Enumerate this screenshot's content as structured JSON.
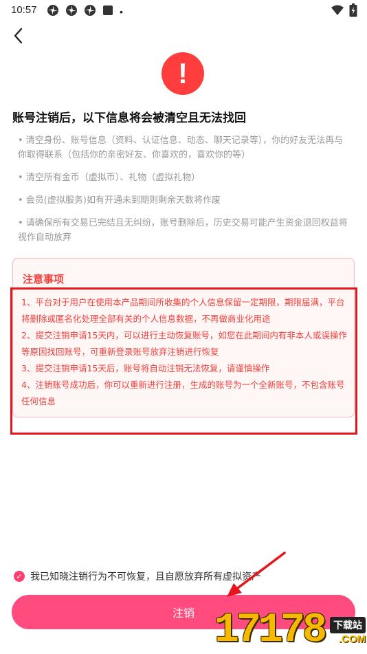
{
  "status_bar": {
    "time": "10:57",
    "icons": [
      "pinwheel-icon",
      "pinwheel-icon",
      "pinwheel-icon",
      "square-icon",
      "dot-icon"
    ],
    "dot": "•"
  },
  "header": {
    "back_icon": "chevron-left-icon"
  },
  "warning_icon": {
    "glyph": "!",
    "color": "#ff3d3d"
  },
  "heading": "账号注销后，以下信息将会被清空且无法找回",
  "info_items": [
    "• 清空身份、账号信息（资料、认证信息、动态、聊天记录等），你的好友无法再与你取得联系（包括你的亲密好友、你喜欢的，喜欢你的等）",
    "• 清空所有金币（虚拟币）、礼物（虚拟礼物）",
    "• 会员(虚拟服务)如有开通未到期则剩余天数将作废",
    "• 请确保所有交易已完结且无纠纷，账号删除后，历史交易可能产生资金退回权益将视作自动放弃"
  ],
  "notice": {
    "title": "注意事项",
    "items": [
      "1、平台对于用户在使用本产品期间所收集的个人信息保留一定期限，期限届满，平台将删除或匿名化处理全部有关的个人信息数据，不再做商业化用途",
      "2、提交注销申请15天内，可以进行主动恢复账号，如您在此期间内有非本人或误操作等原因找回账号，可重新登录账号放弃注销进行恢复",
      "3、提交注销申请15天后，账号将自动注销无法恢复，请谨慎操作",
      "4、注销账号成功后，你可以重新进行注册，生成的账号为一个全新账号，不包含账号任何信息"
    ]
  },
  "agreement": {
    "checked": true,
    "text": "我已知晓注销行为不可恢复，且自愿放弃所有虚拟资产"
  },
  "cancel_button": {
    "label": "注销"
  },
  "watermark": {
    "digits": "17178",
    "tag": "下载站",
    "domain": ".COM"
  },
  "colors": {
    "accent": "#ff4b7d",
    "notice_red": "#f0413c",
    "annotation_red": "#e5151b"
  }
}
